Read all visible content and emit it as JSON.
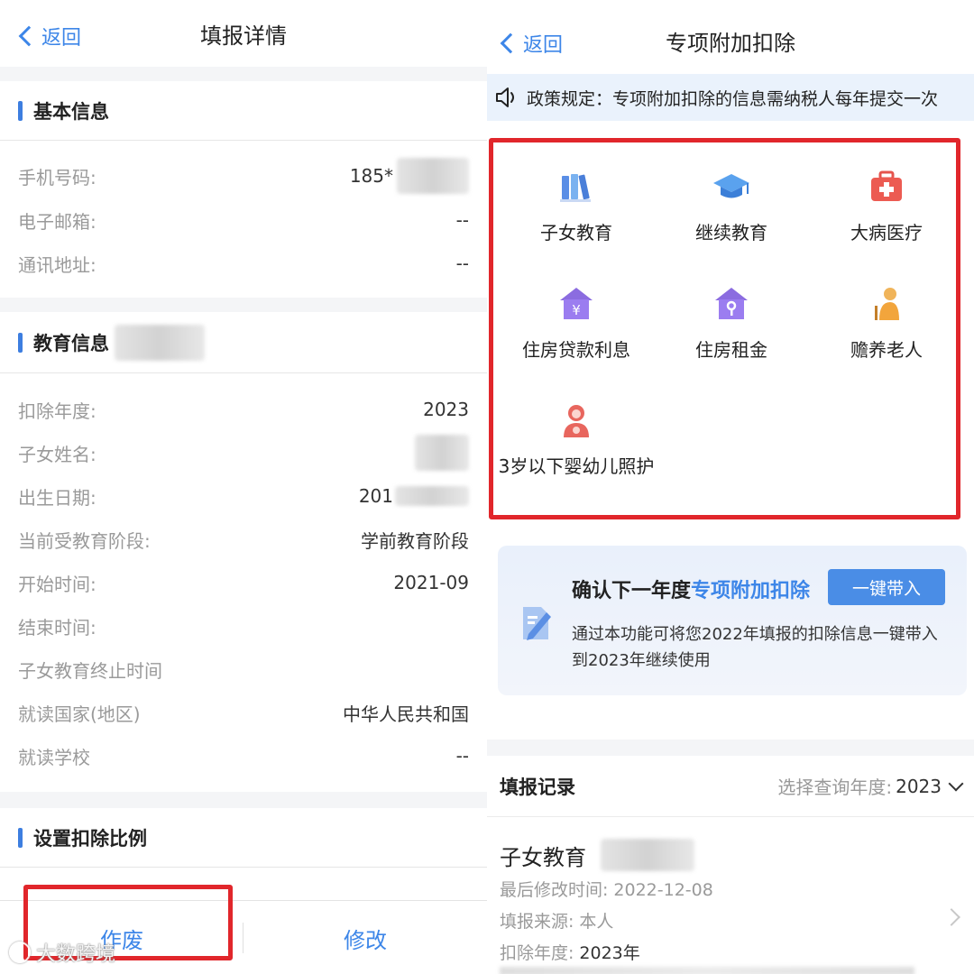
{
  "left": {
    "nav": {
      "back": "返回",
      "title": "填报详情"
    },
    "basic": {
      "title": "基本信息",
      "rows": [
        {
          "label": "手机号码:",
          "value": "185*"
        },
        {
          "label": "电子邮箱:",
          "value": "--"
        },
        {
          "label": "通讯地址:",
          "value": "--"
        }
      ]
    },
    "education": {
      "title": "教育信息",
      "rows": [
        {
          "label": "扣除年度:",
          "value": "2023"
        },
        {
          "label": "子女姓名:",
          "value": ""
        },
        {
          "label": "出生日期:",
          "value": "201"
        },
        {
          "label": "当前受教育阶段:",
          "value": "学前教育阶段"
        },
        {
          "label": "开始时间:",
          "value": "2021-09"
        },
        {
          "label": "结束时间:",
          "value": ""
        },
        {
          "label": "子女教育终止时间",
          "value": ""
        },
        {
          "label": "就读国家(地区)",
          "value": "中华人民共和国"
        },
        {
          "label": "就读学校",
          "value": "--"
        }
      ]
    },
    "ratio": {
      "title": "设置扣除比例"
    },
    "bottom": {
      "void": "作废",
      "modify": "修改"
    },
    "watermark": "大数跨境"
  },
  "right": {
    "nav": {
      "back": "返回",
      "title": "专项附加扣除"
    },
    "notice": "政策规定：专项附加扣除的信息需纳税人每年提交一次",
    "categories": [
      {
        "label": "子女教育",
        "icon": "books-icon"
      },
      {
        "label": "继续教育",
        "icon": "graduation-cap-icon"
      },
      {
        "label": "大病医疗",
        "icon": "medical-kit-icon"
      },
      {
        "label": "住房贷款利息",
        "icon": "house-yuan-icon"
      },
      {
        "label": "住房租金",
        "icon": "house-key-icon"
      },
      {
        "label": "赡养老人",
        "icon": "elderly-icon"
      },
      {
        "label": "3岁以下婴幼儿照护",
        "icon": "infant-care-icon"
      }
    ],
    "promo": {
      "title_prefix": "确认下一年度",
      "title_highlight": "专项附加扣除",
      "button": "一键带入",
      "desc": "通过本功能可将您2022年填报的扣除信息一键带入到2023年继续使用"
    },
    "records": {
      "title": "填报记录",
      "year_label": "选择查询年度:",
      "year": "2023",
      "item": {
        "name": "子女教育",
        "modified_label": "最后修改时间:",
        "modified": "2022-12-08",
        "source_label": "填报来源:",
        "source": "本人",
        "year_label": "扣除年度:",
        "year": "2023年"
      }
    }
  },
  "colors": {
    "accent": "#3d86e8",
    "highlight_box": "#e1262b",
    "notice_bg": "#eaf2fc"
  }
}
